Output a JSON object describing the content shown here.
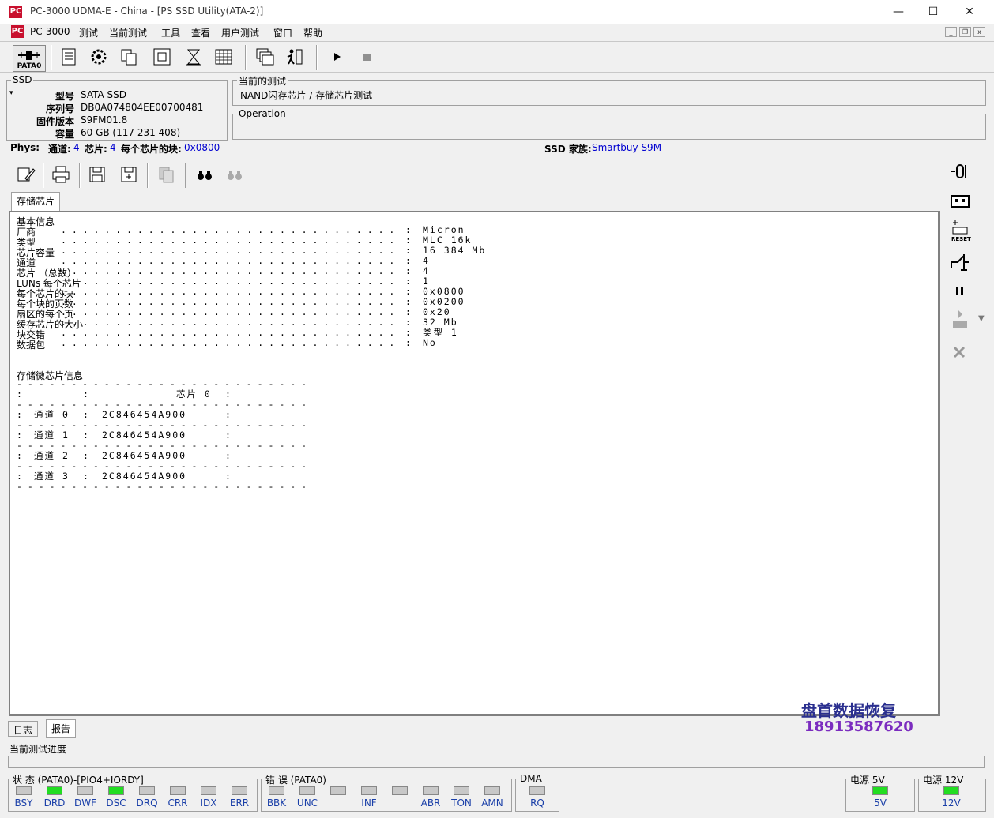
{
  "window": {
    "title": "PC-3000 UDMA-E - China - [PS SSD Utility(ATA-2)]",
    "logo_text": "PC",
    "minimize": "—",
    "maximize": "☐",
    "close": "✕"
  },
  "menu": {
    "items": [
      "PC-3000",
      "测试",
      "当前测试",
      "工具",
      "查看",
      "用户测试",
      "窗口",
      "帮助"
    ]
  },
  "toolbar": {
    "port_label": "PATA0"
  },
  "drive": {
    "group_title": "SSD",
    "model_label": "型号",
    "model": "SATA SSD",
    "serial_label": "序列号",
    "serial": "DB0A074804EE00700481",
    "firmware_label": "固件版本",
    "firmware": "S9FM01.8",
    "capacity_label": "容量",
    "capacity": "60 GB (117 231 408)"
  },
  "current_test": {
    "group_title": "当前的测试",
    "value": "NAND闪存芯片 / 存储芯片测试"
  },
  "operation": {
    "group_title": "Operation"
  },
  "phys": {
    "label": "Phys:",
    "channels_label": "通道:",
    "channels": "4",
    "chips_label": "芯片:",
    "chips": "4",
    "blocks_label": "每个芯片的块:",
    "blocks": "0x0800",
    "family_label": "SSD 家族:",
    "family": "Smartbuy S9M"
  },
  "report_tab": "存储芯片",
  "report": {
    "basic_title": "基本信息",
    "rows": [
      {
        "k": "厂商",
        "v": "Micron"
      },
      {
        "k": "类型",
        "v": "MLC 16k"
      },
      {
        "k": "芯片容量",
        "v": "16 384 Mb"
      },
      {
        "k": "通道",
        "v": "4"
      },
      {
        "k": "芯片 （总数）",
        "v": "4"
      },
      {
        "k": "LUNs 每个芯片",
        "v": "1"
      },
      {
        "k": "每个芯片的块",
        "v": "0x0800"
      },
      {
        "k": "每个块的页数",
        "v": "0x0200"
      },
      {
        "k": "扇区的每个页",
        "v": "0x20"
      },
      {
        "k": "缓存芯片的大小",
        "v": "32 Mb"
      },
      {
        "k": "块交错",
        "v": "类型 1"
      },
      {
        "k": "数据包",
        "v": "No"
      }
    ],
    "chip_title": "存储微芯片信息",
    "chip_header": "芯片 0",
    "channel_label": "通道",
    "chip_rows": [
      {
        "ch": "0",
        "id": "2C846454A900"
      },
      {
        "ch": "1",
        "id": "2C846454A900"
      },
      {
        "ch": "2",
        "id": "2C846454A900"
      },
      {
        "ch": "3",
        "id": "2C846454A900"
      }
    ]
  },
  "bottom_tabs": [
    "日志",
    "报告"
  ],
  "progress_label": "当前测试进度",
  "watermark": {
    "line1": "盘首数据恢复",
    "line2": "18913587620"
  },
  "status": {
    "status_title": "状 态 (PATA0)-[PIO4+IORDY]",
    "status_leds": [
      {
        "name": "BSY",
        "on": false
      },
      {
        "name": "DRD",
        "on": true
      },
      {
        "name": "DWF",
        "on": false
      },
      {
        "name": "DSC",
        "on": true
      },
      {
        "name": "DRQ",
        "on": false
      },
      {
        "name": "CRR",
        "on": false
      },
      {
        "name": "IDX",
        "on": false
      },
      {
        "name": "ERR",
        "on": false
      }
    ],
    "error_title": "错 误 (PATA0)",
    "error_leds": [
      {
        "name": "BBK",
        "on": false
      },
      {
        "name": "UNC",
        "on": false
      },
      {
        "name": "",
        "on": false
      },
      {
        "name": "INF",
        "on": false
      },
      {
        "name": "",
        "on": false
      },
      {
        "name": "ABR",
        "on": false
      },
      {
        "name": "TON",
        "on": false
      },
      {
        "name": "AMN",
        "on": false
      }
    ],
    "dma_title": "DMA",
    "dma_led": "RQ",
    "p5_title": "电源 5V",
    "p5_led": "5V",
    "p12_title": "电源 12V",
    "p12_led": "12V"
  }
}
